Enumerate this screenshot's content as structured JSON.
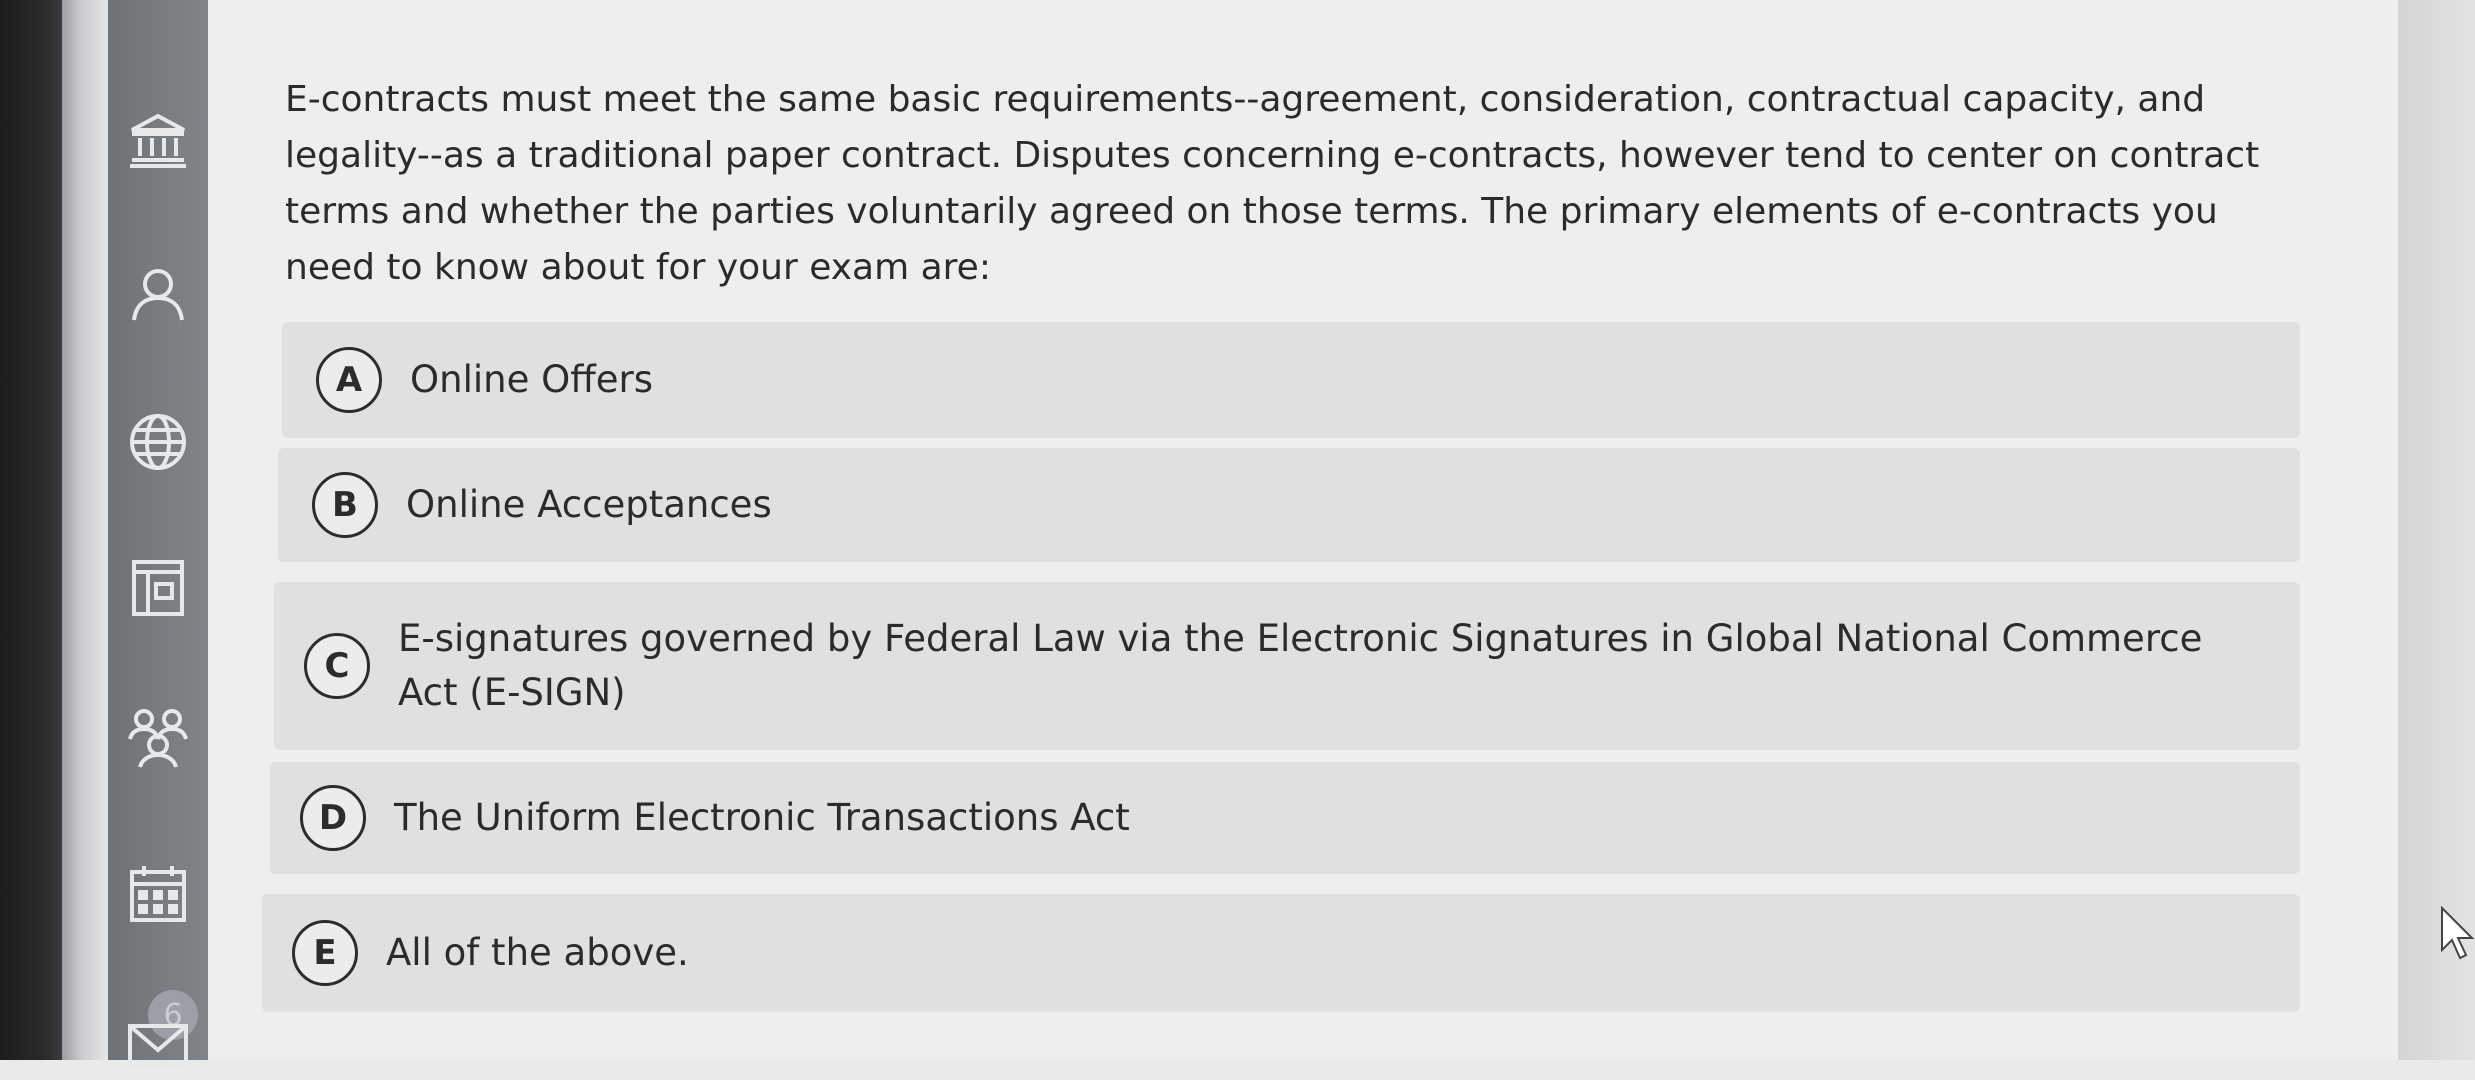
{
  "question": {
    "intro_text": "E-contracts must meet the same basic requirements--agreement, consideration, contractual capacity, and legality--as a traditional paper contract. Disputes concerning e-contracts, however tend to center on contract terms and whether the parties voluntarily agreed on those terms. The primary elements of e-contracts you need to know about for your exam are:"
  },
  "options": [
    {
      "letter": "A",
      "text": "Online Offers"
    },
    {
      "letter": "B",
      "text": "Online Acceptances"
    },
    {
      "letter": "C",
      "text": "E-signatures governed by Federal Law via the Electronic Signatures in Global National Commerce Act (E-SIGN)"
    },
    {
      "letter": "D",
      "text": "The Uniform Electronic Transactions Act"
    },
    {
      "letter": "E",
      "text": "All of the above."
    }
  ],
  "sidebar": {
    "icons": [
      "institution-icon",
      "user-icon",
      "globe-icon",
      "layout-icon",
      "group-icon",
      "calendar-icon",
      "mail-icon"
    ],
    "badge_count": "6"
  },
  "colors": {
    "text": "#2b2b2b",
    "sidebar": "#7a7f84",
    "option_bg": "#e0e0e0"
  }
}
